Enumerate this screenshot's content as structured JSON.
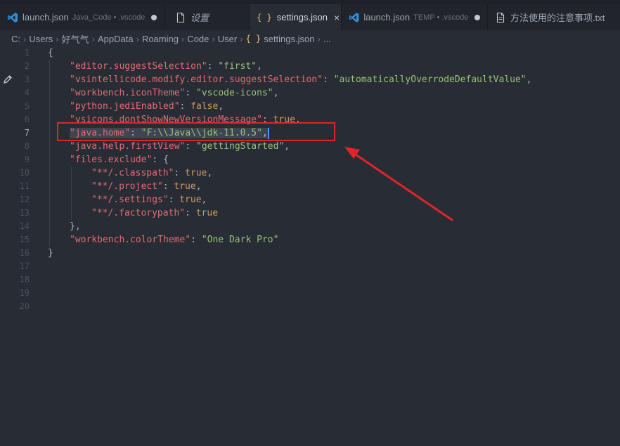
{
  "tabs": [
    {
      "icon": "vscode-icon",
      "name": "launch.json",
      "desc": "Java_Code • .vscode",
      "state": "dot"
    },
    {
      "icon": "file-icon",
      "name": "设置",
      "desc": "",
      "state": "none"
    },
    {
      "icon": "braces-icon",
      "name": "settings.json",
      "desc": "",
      "state": "close",
      "close_glyph": "×",
      "braces": "{ }"
    },
    {
      "icon": "vscode-icon",
      "name": "launch.json",
      "desc": "TEMP • .vscode",
      "state": "dot"
    },
    {
      "icon": "file-icon",
      "name": "方法使用的注意事项.txt",
      "desc": "",
      "state": "none"
    }
  ],
  "breadcrumb": {
    "parts": [
      "C:",
      "Users",
      "好气气",
      "AppData",
      "Roaming",
      "Code",
      "User"
    ],
    "file": "settings.json",
    "braces": "{ }",
    "more": "...",
    "sep": "›"
  },
  "line_numbers": [
    "1",
    "2",
    "3",
    "4",
    "5",
    "6",
    "7",
    "8",
    "9",
    "10",
    "11",
    "12",
    "13",
    "14",
    "15",
    "16",
    "17",
    "18",
    "19",
    "20"
  ],
  "active_line": "7",
  "code": {
    "l1": "{",
    "l2": {
      "key": "\"editor.suggestSelection\"",
      "colon": ": ",
      "val": "\"first\"",
      "comma": ","
    },
    "l3": {
      "key": "\"vsintellicode.modify.editor.suggestSelection\"",
      "colon": ": ",
      "val": "\"automaticallyOverrodeDefaultValue\"",
      "comma": ","
    },
    "l4": {
      "key": "\"workbench.iconTheme\"",
      "colon": ": ",
      "val": "\"vscode-icons\"",
      "comma": ","
    },
    "l5": {
      "key": "\"python.jediEnabled\"",
      "colon": ": ",
      "val": "false",
      "comma": ","
    },
    "l6": {
      "key": "\"vsicons.dontShowNewVersionMessage\"",
      "colon": ": ",
      "val": "true",
      "comma": ","
    },
    "l7": {
      "key": "\"java.home\"",
      "colon": ": ",
      "val": "\"F:\\\\Java\\\\jdk-11.0.5\"",
      "comma": ","
    },
    "l8": {
      "key": "\"java.help.firstView\"",
      "colon": ": ",
      "val": "\"gettingStarted\"",
      "comma": ","
    },
    "l9": {
      "key": "\"files.exclude\"",
      "colon": ": ",
      "val": "{"
    },
    "l10": {
      "key": "\"**/.classpath\"",
      "colon": ": ",
      "val": "true",
      "comma": ","
    },
    "l11": {
      "key": "\"**/.project\"",
      "colon": ": ",
      "val": "true",
      "comma": ","
    },
    "l12": {
      "key": "\"**/.settings\"",
      "colon": ": ",
      "val": "true",
      "comma": ","
    },
    "l13": {
      "key": "\"**/.factorypath\"",
      "colon": ": ",
      "val": "true"
    },
    "l14": "},",
    "l15": {
      "key": "\"workbench.colorTheme\"",
      "colon": ": ",
      "val": "\"One Dark Pro\""
    },
    "l16": "}"
  },
  "colors": {
    "key": "#e06c75",
    "string": "#98c379",
    "constant": "#d19a66",
    "annotation": "#e0242a",
    "vscode_blue": "#2f8fdd",
    "braces": "#e5c07b"
  }
}
